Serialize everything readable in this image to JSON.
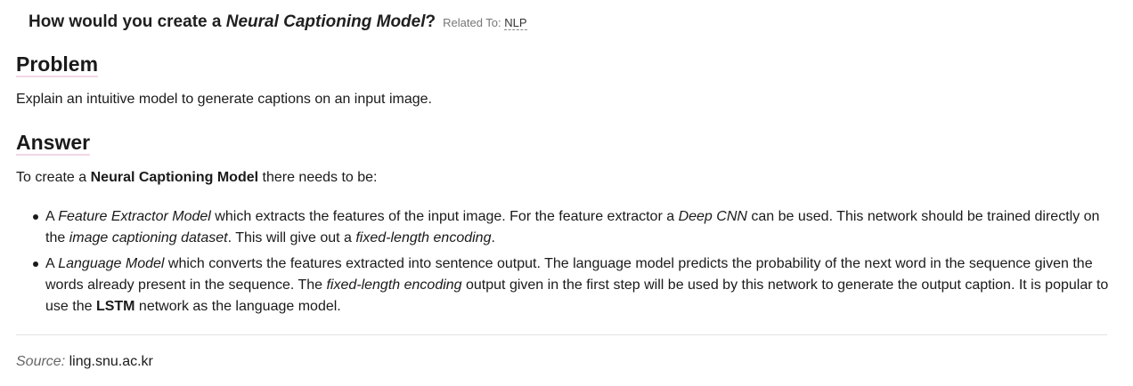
{
  "question": {
    "prefix": "How would you create a ",
    "emphasis": "Neural Captioning Model",
    "suffix": "?",
    "related_label": "Related To:",
    "related_tag": "NLP"
  },
  "problem": {
    "heading": "Problem",
    "text": "Explain an intuitive model to generate captions on an input image."
  },
  "answer": {
    "heading": "Answer",
    "intro_prefix": "To create a ",
    "intro_bold": "Neural Captioning Model",
    "intro_suffix": " there needs to be:",
    "bullet1": {
      "t1": "A ",
      "i1": "Feature Extractor Model",
      "t2": " which extracts the features of the input image. For the feature extractor a ",
      "i2": "Deep CNN",
      "t3": " can be used. This network should be trained directly on the ",
      "i3": "image captioning dataset",
      "t4": ". This will give out a ",
      "i4": "fixed-length encoding",
      "t5": "."
    },
    "bullet2": {
      "t1": "A ",
      "i1": "Language Model",
      "t2": " which converts the features extracted into sentence output. The language model predicts the probability of the next word in the sequence given the words already present in the sequence. The ",
      "i2": "fixed-length encoding",
      "t3": " output given in the first step will be used by this network to generate the output caption. It is popular to use the ",
      "b1": "LSTM",
      "t4": " network as the language model."
    }
  },
  "source": {
    "label": "Source:",
    "value": "ling.snu.ac.kr"
  }
}
